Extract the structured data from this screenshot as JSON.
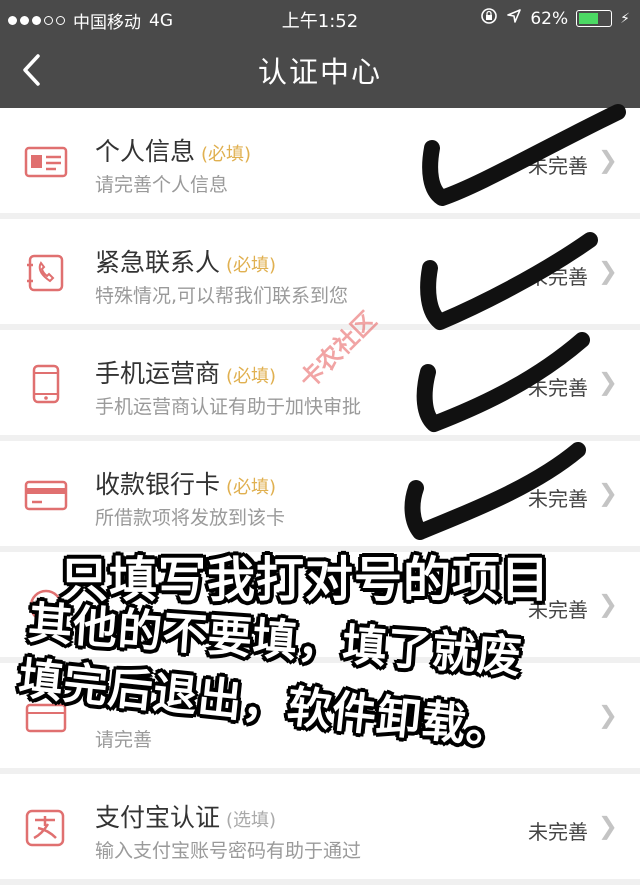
{
  "status_bar": {
    "carrier": "中国移动",
    "network": "4G",
    "time": "上午1:52",
    "battery_percent": "62%",
    "battery_level": 0.62
  },
  "nav": {
    "back_icon": "chevron-left",
    "title": "认证中心"
  },
  "items": [
    {
      "title": "个人信息",
      "tag": "(必填)",
      "desc": "请完善个人信息",
      "status": "未完善",
      "icon": "id-card-icon"
    },
    {
      "title": "紧急联系人",
      "tag": "(必填)",
      "desc": "特殊情况,可以帮我们联系到您",
      "status": "未完善",
      "icon": "phone-book-icon"
    },
    {
      "title": "手机运营商",
      "tag": "(必填)",
      "desc": "手机运营商认证有助于加快审批",
      "status": "未完善",
      "icon": "mobile-phone-icon"
    },
    {
      "title": "收款银行卡",
      "tag": "(必填)",
      "desc": "所借款项将发放到该卡",
      "status": "未完善",
      "icon": "bank-card-icon"
    },
    {
      "title": "",
      "tag": "",
      "desc": "",
      "status": "未完善",
      "icon": "unknown-icon"
    },
    {
      "title": "",
      "tag": "",
      "desc": "请完善",
      "status": "",
      "icon": "card-icon"
    },
    {
      "title": "支付宝认证",
      "tag": "(选填)",
      "desc": "输入支付宝账号密码有助于通过",
      "status": "未完善",
      "icon": "alipay-icon"
    }
  ],
  "overlay": {
    "line1": "只填写我打对号的项目",
    "line2": "其他的不要填，填了就废",
    "line3": "填完后退出，软件卸载。",
    "watermark": "卡农社区"
  },
  "colors": {
    "nav_bg": "#4a4a4a",
    "icon_red": "#e07070",
    "tag_gold": "#e0b050",
    "check_black": "#111111"
  }
}
